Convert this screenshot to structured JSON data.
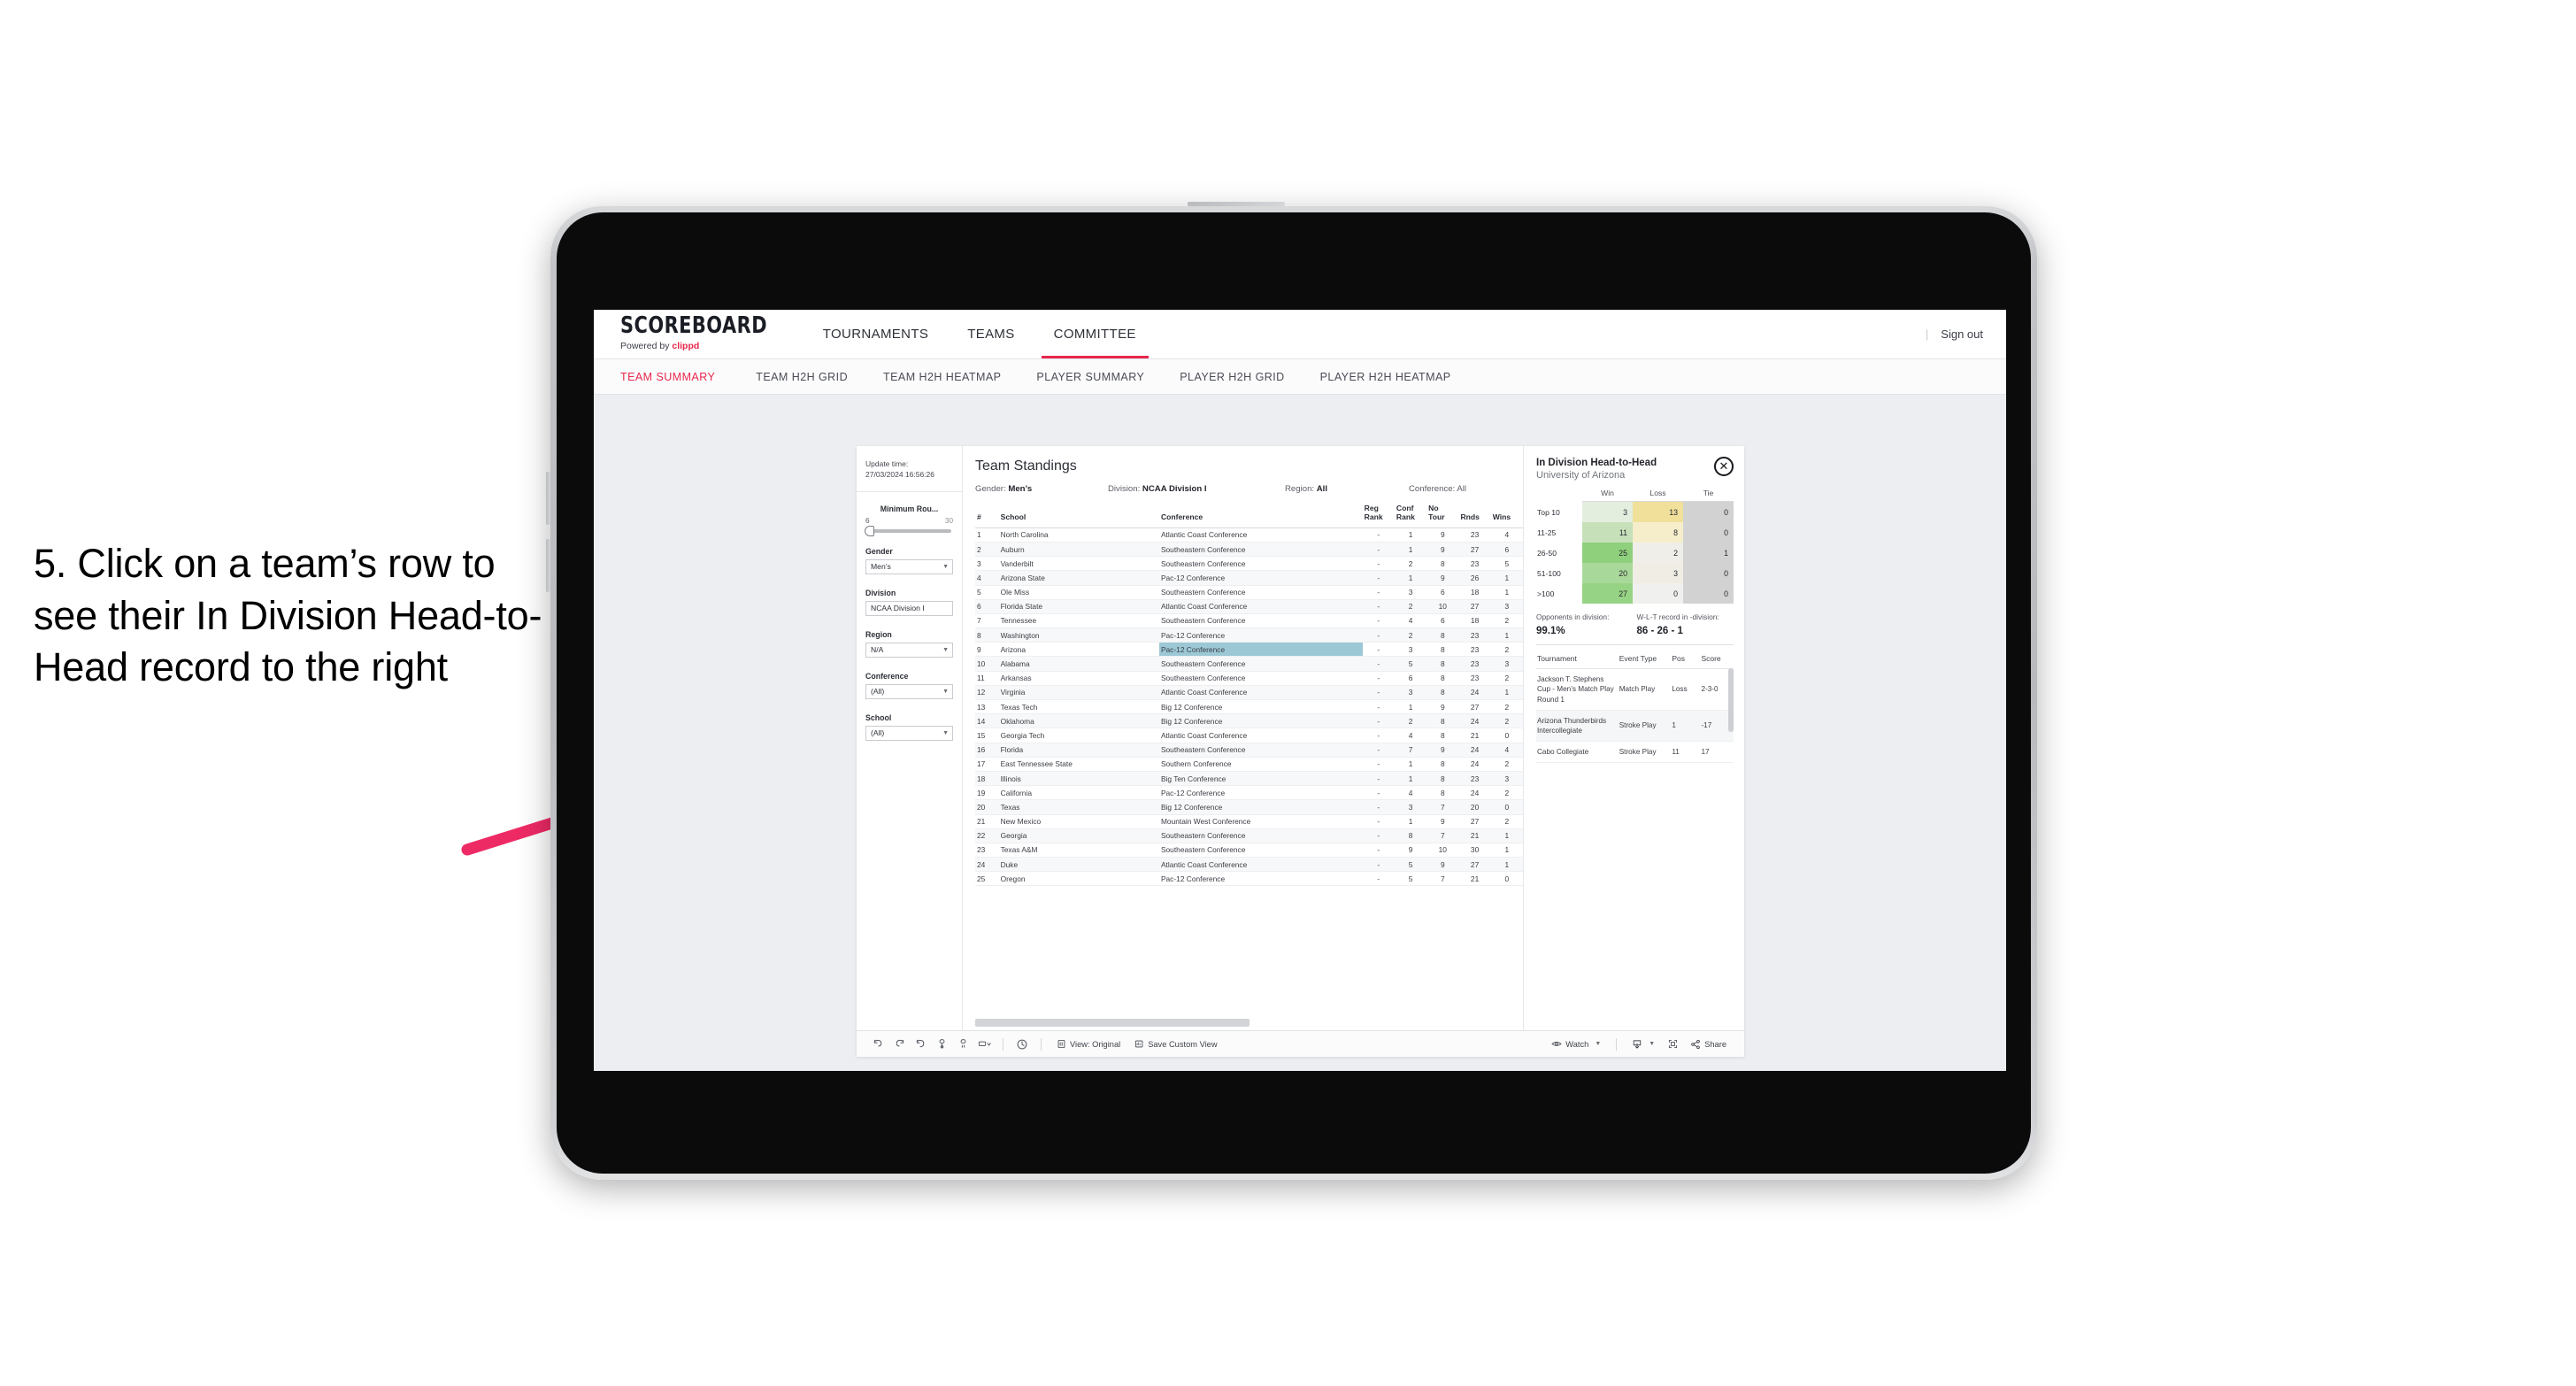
{
  "instruction": {
    "text": "5. Click on a team’s row to see their In Division Head-to-Head record to the right"
  },
  "header": {
    "brand_title": "SCOREBOARD",
    "brand_powered_prefix": "Powered by ",
    "brand_powered_name": "clippd",
    "nav": [
      {
        "label": "TOURNAMENTS",
        "active": false
      },
      {
        "label": "TEAMS",
        "active": false
      },
      {
        "label": "COMMITTEE",
        "active": true
      }
    ],
    "divider": "|",
    "signout": "Sign out"
  },
  "subnav": [
    {
      "label": "TEAM SUMMARY",
      "active": true
    },
    {
      "label": "TEAM H2H GRID",
      "active": false
    },
    {
      "label": "TEAM H2H HEATMAP",
      "active": false
    },
    {
      "label": "PLAYER SUMMARY",
      "active": false
    },
    {
      "label": "PLAYER H2H GRID",
      "active": false
    },
    {
      "label": "PLAYER H2H HEATMAP",
      "active": false
    }
  ],
  "filters": {
    "update_time_label": "Update time:",
    "update_time_value": "27/03/2024 16:56:26",
    "min_rounds": {
      "label": "Minimum Rou...",
      "min": "6",
      "max": "30"
    },
    "gender": {
      "label": "Gender",
      "value": "Men’s"
    },
    "division": {
      "label": "Division",
      "value": "NCAA Division I"
    },
    "region": {
      "label": "Region",
      "value": "N/A"
    },
    "conference": {
      "label": "Conference",
      "value": "(All)"
    },
    "school": {
      "label": "School",
      "value": "(All)"
    }
  },
  "standings": {
    "title": "Team Standings",
    "filter_chips": [
      {
        "label": "Gender: ",
        "value": "Men’s"
      },
      {
        "label": "Division: ",
        "value": "NCAA Division I"
      },
      {
        "label": "Region: ",
        "value": "All"
      },
      {
        "label": "Conference: ",
        "value": "All"
      }
    ],
    "columns": [
      "#",
      "School",
      "Conference",
      "Reg Rank",
      "Conf Rank",
      "No Tour",
      "Rnds",
      "Wins"
    ],
    "rows": [
      {
        "rank": "1",
        "school": "North Carolina",
        "conference": "Atlantic Coast Conference",
        "reg_rank": "-",
        "conf_rank": "1",
        "no_tour": "9",
        "rnds": "23",
        "wins": "4"
      },
      {
        "rank": "2",
        "school": "Auburn",
        "conference": "Southeastern Conference",
        "reg_rank": "-",
        "conf_rank": "1",
        "no_tour": "9",
        "rnds": "27",
        "wins": "6"
      },
      {
        "rank": "3",
        "school": "Vanderbilt",
        "conference": "Southeastern Conference",
        "reg_rank": "-",
        "conf_rank": "2",
        "no_tour": "8",
        "rnds": "23",
        "wins": "5"
      },
      {
        "rank": "4",
        "school": "Arizona State",
        "conference": "Pac-12 Conference",
        "reg_rank": "-",
        "conf_rank": "1",
        "no_tour": "9",
        "rnds": "26",
        "wins": "1"
      },
      {
        "rank": "5",
        "school": "Ole Miss",
        "conference": "Southeastern Conference",
        "reg_rank": "-",
        "conf_rank": "3",
        "no_tour": "6",
        "rnds": "18",
        "wins": "1"
      },
      {
        "rank": "6",
        "school": "Florida State",
        "conference": "Atlantic Coast Conference",
        "reg_rank": "-",
        "conf_rank": "2",
        "no_tour": "10",
        "rnds": "27",
        "wins": "3"
      },
      {
        "rank": "7",
        "school": "Tennessee",
        "conference": "Southeastern Conference",
        "reg_rank": "-",
        "conf_rank": "4",
        "no_tour": "6",
        "rnds": "18",
        "wins": "2"
      },
      {
        "rank": "8",
        "school": "Washington",
        "conference": "Pac-12 Conference",
        "reg_rank": "-",
        "conf_rank": "2",
        "no_tour": "8",
        "rnds": "23",
        "wins": "1"
      },
      {
        "rank": "9",
        "school": "Arizona",
        "conference": "Pac-12 Conference",
        "reg_rank": "-",
        "conf_rank": "3",
        "no_tour": "8",
        "rnds": "23",
        "wins": "2",
        "selected": true
      },
      {
        "rank": "10",
        "school": "Alabama",
        "conference": "Southeastern Conference",
        "reg_rank": "-",
        "conf_rank": "5",
        "no_tour": "8",
        "rnds": "23",
        "wins": "3"
      },
      {
        "rank": "11",
        "school": "Arkansas",
        "conference": "Southeastern Conference",
        "reg_rank": "-",
        "conf_rank": "6",
        "no_tour": "8",
        "rnds": "23",
        "wins": "2"
      },
      {
        "rank": "12",
        "school": "Virginia",
        "conference": "Atlantic Coast Conference",
        "reg_rank": "-",
        "conf_rank": "3",
        "no_tour": "8",
        "rnds": "24",
        "wins": "1"
      },
      {
        "rank": "13",
        "school": "Texas Tech",
        "conference": "Big 12 Conference",
        "reg_rank": "-",
        "conf_rank": "1",
        "no_tour": "9",
        "rnds": "27",
        "wins": "2"
      },
      {
        "rank": "14",
        "school": "Oklahoma",
        "conference": "Big 12 Conference",
        "reg_rank": "-",
        "conf_rank": "2",
        "no_tour": "8",
        "rnds": "24",
        "wins": "2"
      },
      {
        "rank": "15",
        "school": "Georgia Tech",
        "conference": "Atlantic Coast Conference",
        "reg_rank": "-",
        "conf_rank": "4",
        "no_tour": "8",
        "rnds": "21",
        "wins": "0"
      },
      {
        "rank": "16",
        "school": "Florida",
        "conference": "Southeastern Conference",
        "reg_rank": "-",
        "conf_rank": "7",
        "no_tour": "9",
        "rnds": "24",
        "wins": "4"
      },
      {
        "rank": "17",
        "school": "East Tennessee State",
        "conference": "Southern Conference",
        "reg_rank": "-",
        "conf_rank": "1",
        "no_tour": "8",
        "rnds": "24",
        "wins": "2"
      },
      {
        "rank": "18",
        "school": "Illinois",
        "conference": "Big Ten Conference",
        "reg_rank": "-",
        "conf_rank": "1",
        "no_tour": "8",
        "rnds": "23",
        "wins": "3"
      },
      {
        "rank": "19",
        "school": "California",
        "conference": "Pac-12 Conference",
        "reg_rank": "-",
        "conf_rank": "4",
        "no_tour": "8",
        "rnds": "24",
        "wins": "2"
      },
      {
        "rank": "20",
        "school": "Texas",
        "conference": "Big 12 Conference",
        "reg_rank": "-",
        "conf_rank": "3",
        "no_tour": "7",
        "rnds": "20",
        "wins": "0"
      },
      {
        "rank": "21",
        "school": "New Mexico",
        "conference": "Mountain West Conference",
        "reg_rank": "-",
        "conf_rank": "1",
        "no_tour": "9",
        "rnds": "27",
        "wins": "2"
      },
      {
        "rank": "22",
        "school": "Georgia",
        "conference": "Southeastern Conference",
        "reg_rank": "-",
        "conf_rank": "8",
        "no_tour": "7",
        "rnds": "21",
        "wins": "1"
      },
      {
        "rank": "23",
        "school": "Texas A&M",
        "conference": "Southeastern Conference",
        "reg_rank": "-",
        "conf_rank": "9",
        "no_tour": "10",
        "rnds": "30",
        "wins": "1"
      },
      {
        "rank": "24",
        "school": "Duke",
        "conference": "Atlantic Coast Conference",
        "reg_rank": "-",
        "conf_rank": "5",
        "no_tour": "9",
        "rnds": "27",
        "wins": "1"
      },
      {
        "rank": "25",
        "school": "Oregon",
        "conference": "Pac-12 Conference",
        "reg_rank": "-",
        "conf_rank": "5",
        "no_tour": "7",
        "rnds": "21",
        "wins": "0"
      }
    ]
  },
  "h2h": {
    "title": "In Division Head-to-Head",
    "subtitle": "University of Arizona",
    "close_glyph": "✕",
    "columns": [
      "",
      "Win",
      "Loss",
      "Tie"
    ],
    "rows": [
      {
        "band": "Top 10",
        "win": "3",
        "loss": "13",
        "tie": "0",
        "win_color": "#e3eedf",
        "loss_color": "#f0e09a",
        "tie_color": "#d2d2d2"
      },
      {
        "band": "11-25",
        "win": "11",
        "loss": "8",
        "tie": "0",
        "win_color": "#c6e1b9",
        "loss_color": "#f6eecb",
        "tie_color": "#d2d2d2"
      },
      {
        "band": "26-50",
        "win": "25",
        "loss": "2",
        "tie": "1",
        "win_color": "#8fd07c",
        "loss_color": "#efeee8",
        "tie_color": "#d2d2d2"
      },
      {
        "band": "51-100",
        "win": "20",
        "loss": "3",
        "tie": "0",
        "win_color": "#a9d99a",
        "loss_color": "#f0eee4",
        "tie_color": "#d2d2d2"
      },
      {
        "band": ">100",
        "win": "27",
        "loss": "0",
        "tie": "0",
        "win_color": "#97d384",
        "loss_color": "#f0f0ee",
        "tie_color": "#d2d2d2"
      }
    ],
    "stats": [
      {
        "label": "Opponents in division:",
        "value": "99.1%"
      },
      {
        "label": "W-L-T record in -division:",
        "value": "86 - 26 - 1"
      }
    ],
    "tournament_columns": [
      "Tournament",
      "Event Type",
      "Pos",
      "Score"
    ],
    "tournaments": [
      {
        "name": "Jackson T. Stephens Cup - Men’s Match Play Round 1",
        "type": "Match Play",
        "pos": "Loss",
        "score": "2-3-0"
      },
      {
        "name": "Arizona Thunderbirds Intercollegiate",
        "type": "Stroke Play",
        "pos": "1",
        "score": "-17"
      },
      {
        "name": "Cabo Collegiate",
        "type": "Stroke Play",
        "pos": "11",
        "score": "17"
      }
    ]
  },
  "toolbar": {
    "view_label": "View: Original",
    "save_label": "Save Custom View",
    "watch_label": "Watch",
    "share_label": "Share"
  },
  "colors": {
    "accent": "#e8274b",
    "selected_row": "#9cc8d6",
    "arrow": "#ee2a65"
  }
}
